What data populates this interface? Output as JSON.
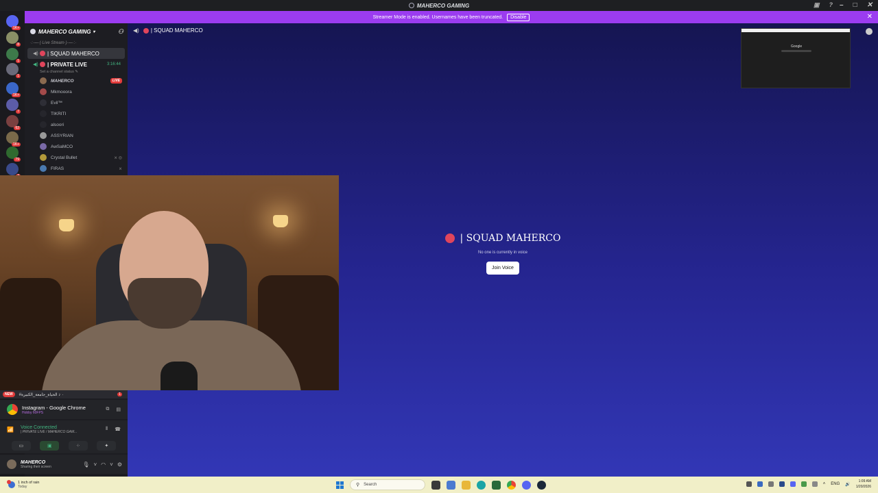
{
  "window": {
    "title": "MAHERCO GAMING"
  },
  "banner": {
    "text": "Streamer Mode is enabled. Usernames have been truncated.",
    "disable_label": "Disable"
  },
  "rail_badges": [
    "1K+",
    "8",
    "1",
    "1",
    "1K+",
    "7",
    "62",
    "1K+",
    "79",
    "3"
  ],
  "sidebar": {
    "guild_name": "MAHERCO GAMING",
    "category": "·:·—·(·Live Stream·)·—·:·",
    "channels": [
      {
        "name": "| SQUAD MAHERCO",
        "active": true
      },
      {
        "name": "| PRIVATE LIVE",
        "timer": "3:16:44",
        "status": "Set a channel status"
      }
    ],
    "voice_users": [
      {
        "name": "MAHERCO",
        "live": "LIVE"
      },
      {
        "name": "Mkmooora"
      },
      {
        "name": "Evil™"
      },
      {
        "name": "TIKRITI"
      },
      {
        "name": "alsoori"
      },
      {
        "name": "ASSYRIAN"
      },
      {
        "name": "AwSaMCO"
      },
      {
        "name": "Crystal Bullet"
      },
      {
        "name": "FIRAS"
      }
    ]
  },
  "stage": {
    "header": "| SQUAD MAHERCO",
    "title": "| SQUAD MAHERCO",
    "subtitle": "No one is currently in voice",
    "join_label": "Join Voice",
    "preview_logo": "Google"
  },
  "dm_row": {
    "new": "NEW",
    "text": "#٠ ♪ الحياة_جامعة_الكبيرة",
    "count": "1"
  },
  "activity": {
    "title": "Instagram - Google Chrome",
    "sub": "Hobby 60FPS"
  },
  "voice": {
    "status": "Voice Connected",
    "channel": "| PRIVATE LIVE / MAHERCO GAM..."
  },
  "user": {
    "name": "MAHERCO",
    "status": "Sharing their screen"
  },
  "taskbar": {
    "weather_line1": "1 inch of rain",
    "weather_line2": "Today",
    "search_placeholder": "Search",
    "lang": "ENG",
    "time": "1:09 AM",
    "date": "1/20/2026"
  },
  "colors": {
    "accent_banner": "#9b3cf0",
    "live_red": "#e23b3b",
    "voice_green": "#43b581"
  }
}
